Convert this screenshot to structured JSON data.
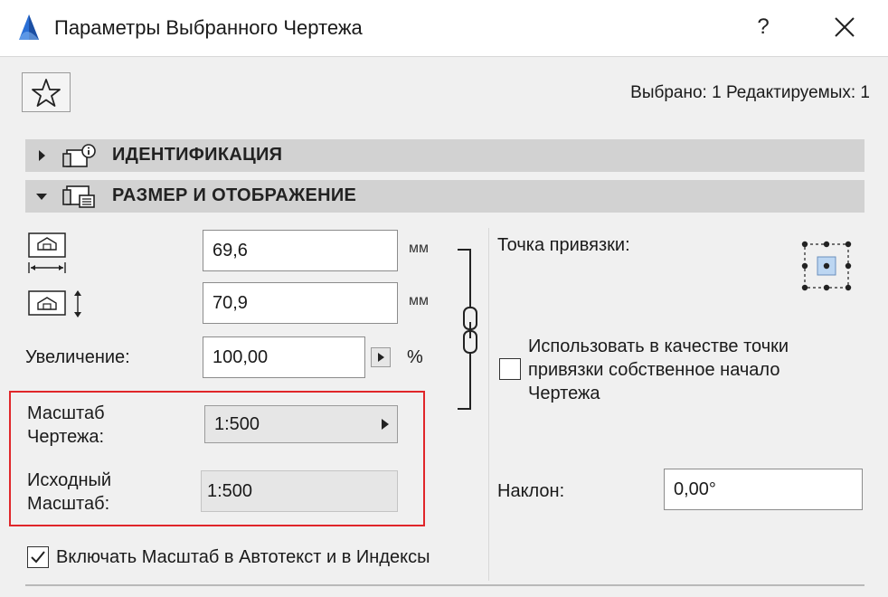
{
  "window": {
    "title": "Параметры Выбранного Чертежа",
    "help_label": "?"
  },
  "header": {
    "selection_info": "Выбрано: 1 Редактируемых: 1"
  },
  "sections": [
    {
      "label": "ИДЕНТИФИКАЦИЯ",
      "expanded": false
    },
    {
      "label": "РАЗМЕР И ОТОБРАЖЕНИЕ",
      "expanded": true
    }
  ],
  "size": {
    "width_value": "69,6",
    "width_unit": "мм",
    "height_value": "70,9",
    "height_unit": "мм",
    "zoom_label": "Увеличение:",
    "zoom_value": "100,00",
    "zoom_unit": "%"
  },
  "scale": {
    "drawing_scale_label_line1": "Масштаб",
    "drawing_scale_label_line2": "Чертежа:",
    "drawing_scale_value": "1:500",
    "original_scale_label_line1": "Исходный",
    "original_scale_label_line2": "Масштаб:",
    "original_scale_value": "1:500"
  },
  "anchor": {
    "label": "Точка привязки:",
    "use_origin_line1": "Использовать в качестве точки",
    "use_origin_line2": "привязки собственное начало",
    "use_origin_line3": "Чертежа",
    "use_origin_checked": false
  },
  "tilt": {
    "label": "Наклон:",
    "value": "0,00°"
  },
  "include_scale": {
    "label": "Включать Масштаб в Автотекст и в Индексы",
    "checked": true
  },
  "colors": {
    "highlight_border": "#e0262a",
    "anchor_selected": "#bcd6f2",
    "logo_blue": "#2a6fd6"
  }
}
